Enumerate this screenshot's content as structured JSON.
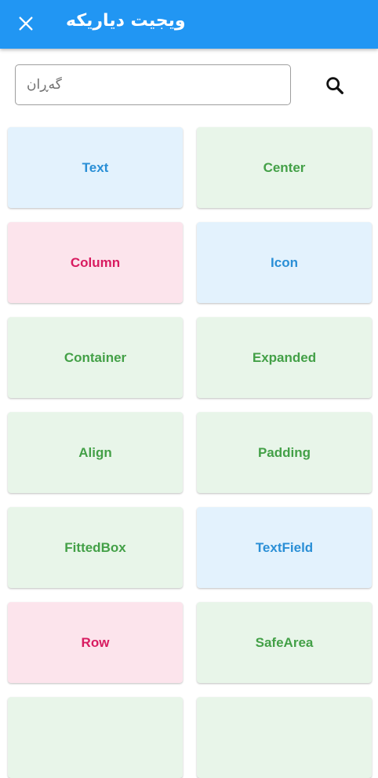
{
  "appbar": {
    "title": "ویجیت دیاریکە",
    "close_icon": "close-icon"
  },
  "search": {
    "placeholder": "گەڕان",
    "value": "",
    "icon": "search-icon"
  },
  "widgets": [
    {
      "label": "Text",
      "color": "blue"
    },
    {
      "label": "Center",
      "color": "green"
    },
    {
      "label": "Column",
      "color": "pink"
    },
    {
      "label": "Icon",
      "color": "blue"
    },
    {
      "label": "Container",
      "color": "green"
    },
    {
      "label": "Expanded",
      "color": "green"
    },
    {
      "label": "Align",
      "color": "green"
    },
    {
      "label": "Padding",
      "color": "green"
    },
    {
      "label": "FittedBox",
      "color": "green"
    },
    {
      "label": "TextField",
      "color": "blue"
    },
    {
      "label": "Row",
      "color": "pink"
    },
    {
      "label": "SafeArea",
      "color": "green"
    },
    {
      "label": "",
      "color": "green"
    },
    {
      "label": "",
      "color": "green"
    }
  ],
  "colors": {
    "appbar": "#2196f3",
    "blue_bg": "#e3f2fd",
    "blue_text": "#2a8fd6",
    "green_bg": "#e8f5e9",
    "green_text": "#43a047",
    "pink_bg": "#fce4ec",
    "pink_text": "#d81b60"
  }
}
